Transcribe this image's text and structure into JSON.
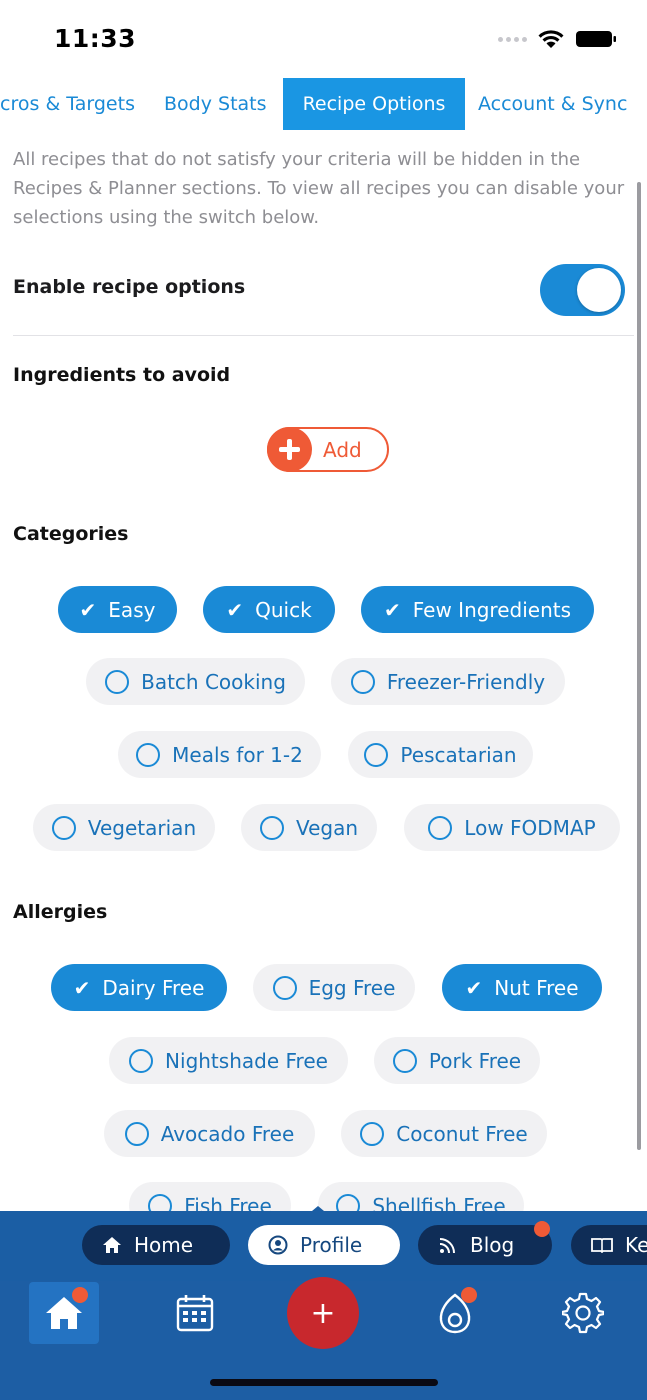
{
  "status_bar": {
    "time": "11:33"
  },
  "tabs": [
    {
      "label": "Macros & Targets"
    },
    {
      "label": "Body Stats"
    },
    {
      "label": "Recipe Options",
      "active": true
    },
    {
      "label": "Account & Sync"
    }
  ],
  "intro_text": "All recipes that do not satisfy your criteria will be hidden in the Recipes & Planner sections. To view all recipes you can disable your selections using the switch below.",
  "enable_recipe_options": {
    "label": "Enable recipe options",
    "enabled": true
  },
  "ingredients": {
    "title": "Ingredients to avoid",
    "add_label": "Add"
  },
  "categories": {
    "title": "Categories",
    "items": [
      {
        "label": "Easy",
        "selected": true
      },
      {
        "label": "Quick",
        "selected": true
      },
      {
        "label": "Few Ingredients",
        "selected": true
      },
      {
        "label": "Batch Cooking",
        "selected": false
      },
      {
        "label": "Freezer-Friendly",
        "selected": false
      },
      {
        "label": "Meals for 1-2",
        "selected": false
      },
      {
        "label": "Pescatarian",
        "selected": false
      },
      {
        "label": "Vegetarian",
        "selected": false
      },
      {
        "label": "Vegan",
        "selected": false
      },
      {
        "label": "Low FODMAP",
        "selected": false
      }
    ]
  },
  "allergies": {
    "title": "Allergies",
    "items": [
      {
        "label": "Dairy Free",
        "selected": true
      },
      {
        "label": "Egg Free",
        "selected": false
      },
      {
        "label": "Nut Free",
        "selected": true
      },
      {
        "label": "Nightshade Free",
        "selected": false
      },
      {
        "label": "Pork Free",
        "selected": false
      },
      {
        "label": "Avocado Free",
        "selected": false
      },
      {
        "label": "Coconut Free",
        "selected": false
      },
      {
        "label": "Fish Free",
        "selected": false
      },
      {
        "label": "Shellfish Free",
        "selected": false
      }
    ]
  },
  "pill_nav": [
    {
      "label": "Home",
      "icon": "home-icon"
    },
    {
      "label": "Profile",
      "icon": "person-icon",
      "active": true
    },
    {
      "label": "Blog",
      "icon": "rss-icon",
      "badge": true
    },
    {
      "label": "Ke",
      "icon": "book-icon"
    }
  ],
  "bottom_nav": [
    {
      "icon": "home-icon",
      "active": true,
      "badge": true
    },
    {
      "icon": "calendar-icon"
    },
    {
      "icon": "plus-icon",
      "fab": true,
      "label": "+"
    },
    {
      "icon": "avocado-icon",
      "badge": true
    },
    {
      "icon": "gear-icon"
    }
  ],
  "colors": {
    "accent": "#1a8ad6",
    "chip_off_bg": "#f1f1f3",
    "add_orange": "#ef5a36",
    "nav_blue": "#1d5ea4",
    "fab_red": "#c8282d"
  }
}
